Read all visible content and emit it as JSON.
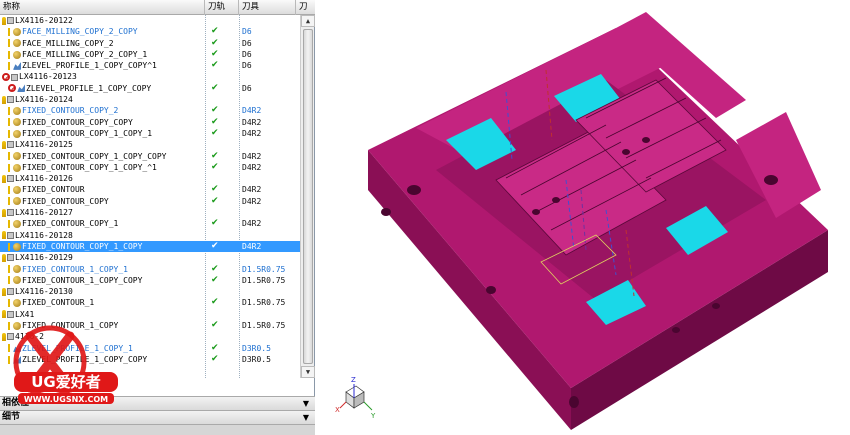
{
  "navigator": {
    "columns": {
      "name": "称称",
      "path": "刀轨",
      "tool": "刀具",
      "more": "刀"
    },
    "rows": [
      {
        "level": 1,
        "icons": [
          "key",
          "folder"
        ],
        "name": "LX4116-20122",
        "path": "",
        "tool": "",
        "style": "normal"
      },
      {
        "level": 2,
        "icons": [
          "check",
          "op"
        ],
        "name": "FACE_MILLING_COPY_2_COPY",
        "path": "✔",
        "tool": "D6",
        "style": "blue"
      },
      {
        "level": 2,
        "icons": [
          "check",
          "op"
        ],
        "name": "FACE_MILLING_COPY_2",
        "path": "✔",
        "tool": "D6",
        "style": "black"
      },
      {
        "level": 2,
        "icons": [
          "check",
          "op"
        ],
        "name": "FACE_MILLING_COPY_2_COPY_1",
        "path": "✔",
        "tool": "D6",
        "style": "black"
      },
      {
        "level": 2,
        "icons": [
          "check",
          "path"
        ],
        "name": "ZLEVEL_PROFILE_1_COPY_COPY^1",
        "path": "✔",
        "tool": "D6",
        "style": "black"
      },
      {
        "level": 1,
        "icons": [
          "stop",
          "folder"
        ],
        "name": "LX4116-20123",
        "path": "",
        "tool": "",
        "style": "normal"
      },
      {
        "level": 2,
        "icons": [
          "stop",
          "path"
        ],
        "name": "ZLEVEL_PROFILE_1_COPY_COPY",
        "path": "✔",
        "tool": "D6",
        "style": "black"
      },
      {
        "level": 1,
        "icons": [
          "key",
          "folder"
        ],
        "name": "LX4116-20124",
        "path": "",
        "tool": "",
        "style": "normal"
      },
      {
        "level": 2,
        "icons": [
          "check",
          "op"
        ],
        "name": "FIXED_CONTOUR_COPY_2",
        "path": "✔",
        "tool": "D4R2",
        "style": "blue"
      },
      {
        "level": 2,
        "icons": [
          "check",
          "op"
        ],
        "name": "FIXED_CONTOUR_COPY_COPY",
        "path": "✔",
        "tool": "D4R2",
        "style": "black"
      },
      {
        "level": 2,
        "icons": [
          "check",
          "op"
        ],
        "name": "FIXED_CONTOUR_COPY_1_COPY_1",
        "path": "✔",
        "tool": "D4R2",
        "style": "black"
      },
      {
        "level": 1,
        "icons": [
          "key",
          "folder"
        ],
        "name": "LX4116-20125",
        "path": "",
        "tool": "",
        "style": "normal"
      },
      {
        "level": 2,
        "icons": [
          "check",
          "op"
        ],
        "name": "FIXED_CONTOUR_COPY_1_COPY_COPY",
        "path": "✔",
        "tool": "D4R2",
        "style": "black"
      },
      {
        "level": 2,
        "icons": [
          "check",
          "op"
        ],
        "name": "FIXED_CONTOUR_COPY_1_COPY_^1",
        "path": "✔",
        "tool": "D4R2",
        "style": "black"
      },
      {
        "level": 1,
        "icons": [
          "key",
          "folder"
        ],
        "name": "LX4116-20126",
        "path": "",
        "tool": "",
        "style": "normal"
      },
      {
        "level": 2,
        "icons": [
          "check",
          "op"
        ],
        "name": "FIXED_CONTOUR",
        "path": "✔",
        "tool": "D4R2",
        "style": "black"
      },
      {
        "level": 2,
        "icons": [
          "check",
          "op"
        ],
        "name": "FIXED_CONTOUR_COPY",
        "path": "✔",
        "tool": "D4R2",
        "style": "black"
      },
      {
        "level": 1,
        "icons": [
          "key",
          "folder"
        ],
        "name": "LX4116-20127",
        "path": "",
        "tool": "",
        "style": "normal"
      },
      {
        "level": 2,
        "icons": [
          "check",
          "op"
        ],
        "name": "FIXED_CONTOUR_COPY_1",
        "path": "✔",
        "tool": "D4R2",
        "style": "black"
      },
      {
        "level": 1,
        "icons": [
          "key",
          "folder"
        ],
        "name": "LX4116-20128",
        "path": "",
        "tool": "",
        "style": "normal"
      },
      {
        "level": 2,
        "icons": [
          "check",
          "op"
        ],
        "name": "FIXED_CONTOUR_COPY_1_COPY",
        "path": "✔",
        "tool": "D4R2",
        "style": "selected"
      },
      {
        "level": 1,
        "icons": [
          "key",
          "folder"
        ],
        "name": "LX4116-20129",
        "path": "",
        "tool": "",
        "style": "normal"
      },
      {
        "level": 2,
        "icons": [
          "check",
          "op"
        ],
        "name": "FIXED_CONTOUR_1_COPY_1",
        "path": "✔",
        "tool": "D1.5R0.75",
        "style": "blue"
      },
      {
        "level": 2,
        "icons": [
          "check",
          "op"
        ],
        "name": "FIXED_CONTOUR_1_COPY_COPY",
        "path": "✔",
        "tool": "D1.5R0.75",
        "style": "black"
      },
      {
        "level": 1,
        "icons": [
          "key",
          "folder"
        ],
        "name": "LX4116-20130",
        "path": "",
        "tool": "",
        "style": "normal"
      },
      {
        "level": 2,
        "icons": [
          "check",
          "op"
        ],
        "name": "FIXED_CONTOUR_1",
        "path": "✔",
        "tool": "D1.5R0.75",
        "style": "black"
      },
      {
        "level": 1,
        "icons": [
          "key",
          "folder"
        ],
        "name": "LX41",
        "path": "",
        "tool": "",
        "style": "normal"
      },
      {
        "level": 2,
        "icons": [
          "check",
          "op"
        ],
        "name": "FIXED_CONTOUR_1_COPY",
        "path": "✔",
        "tool": "D1.5R0.75",
        "style": "black"
      },
      {
        "level": 1,
        "icons": [
          "key",
          "folder"
        ],
        "name": "4116-2",
        "path": "",
        "tool": "",
        "style": "normal"
      },
      {
        "level": 2,
        "icons": [
          "check",
          "path"
        ],
        "name": "ZLEVEL_PROFILE_1_COPY_1",
        "path": "✔",
        "tool": "D3R0.5",
        "style": "blue"
      },
      {
        "level": 2,
        "icons": [
          "check",
          "path"
        ],
        "name": "ZLEVEL_PROFILE_1_COPY_COPY",
        "path": "✔",
        "tool": "D3R0.5",
        "style": "black"
      }
    ]
  },
  "panels": {
    "dependencies": "相依性",
    "details": "细节"
  },
  "watermark": {
    "brand": "UG爱好者",
    "url": "WWW.UGSNX.COM"
  },
  "colors": {
    "part": "#b0186f",
    "part_light": "#d93a95",
    "part_dark": "#6e0a45",
    "cyan": "#1ad8e8",
    "selection": "#3399ff"
  },
  "viewport": {
    "triad_labels": [
      "X",
      "Y",
      "Z"
    ]
  }
}
